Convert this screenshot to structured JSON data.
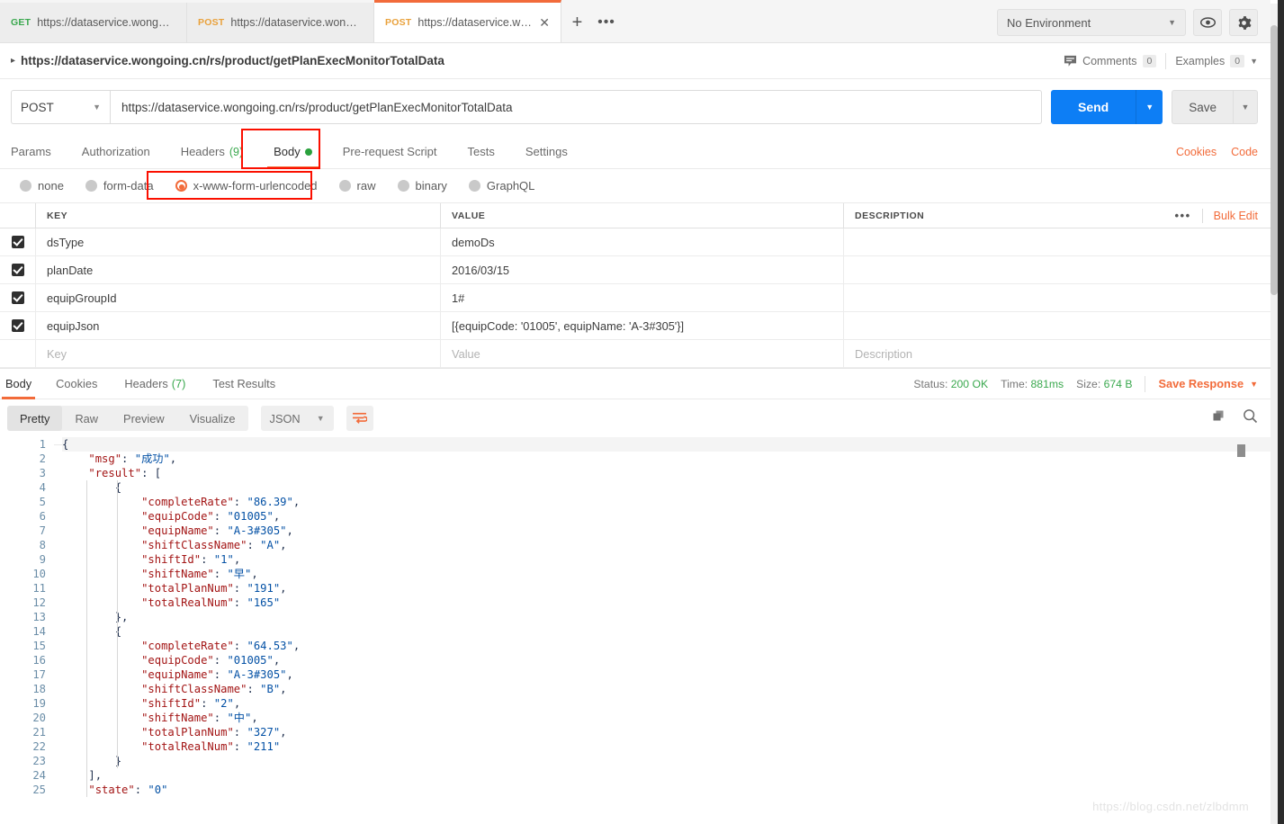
{
  "tabbar": {
    "tabs": [
      {
        "verb": "GET",
        "url": "https://dataservice.wongoing.c...",
        "active": false
      },
      {
        "verb": "POST",
        "url": "https://dataservice.wongoing....",
        "active": false
      },
      {
        "verb": "POST",
        "url": "https://dataservice.wongoing....",
        "active": true
      }
    ],
    "new_tab_label": "+",
    "more_label": "•••",
    "environment": "No Environment",
    "eye_icon": "eye-icon",
    "gear_icon": "gear-icon"
  },
  "breadcrumb": {
    "title": "https://dataservice.wongoing.cn/rs/product/getPlanExecMonitorTotalData",
    "comments_label": "Comments",
    "comments_count": "0",
    "examples_label": "Examples",
    "examples_count": "0"
  },
  "urlbar": {
    "method": "POST",
    "url": "https://dataservice.wongoing.cn/rs/product/getPlanExecMonitorTotalData",
    "send_label": "Send",
    "save_label": "Save"
  },
  "request_tabs": {
    "items": [
      {
        "label": "Params",
        "badge": "",
        "dot": false,
        "active": false
      },
      {
        "label": "Authorization",
        "badge": "",
        "dot": false,
        "active": false
      },
      {
        "label": "Headers",
        "badge": "(9)",
        "dot": false,
        "active": false
      },
      {
        "label": "Body",
        "badge": "",
        "dot": true,
        "active": true
      },
      {
        "label": "Pre-request Script",
        "badge": "",
        "dot": false,
        "active": false
      },
      {
        "label": "Tests",
        "badge": "",
        "dot": false,
        "active": false
      },
      {
        "label": "Settings",
        "badge": "",
        "dot": false,
        "active": false
      }
    ],
    "cookies_label": "Cookies",
    "code_label": "Code"
  },
  "body_types": {
    "options": [
      {
        "label": "none",
        "selected": false
      },
      {
        "label": "form-data",
        "selected": false
      },
      {
        "label": "x-www-form-urlencoded",
        "selected": true
      },
      {
        "label": "raw",
        "selected": false
      },
      {
        "label": "binary",
        "selected": false
      },
      {
        "label": "GraphQL",
        "selected": false
      }
    ]
  },
  "kvtable": {
    "headers": {
      "key": "KEY",
      "value": "VALUE",
      "description": "DESCRIPTION"
    },
    "dots_label": "•••",
    "bulk_edit_label": "Bulk Edit",
    "rows": [
      {
        "checked": true,
        "key": "dsType",
        "value": "demoDs",
        "description": ""
      },
      {
        "checked": true,
        "key": "planDate",
        "value": "2016/03/15",
        "description": ""
      },
      {
        "checked": true,
        "key": "equipGroupId",
        "value": "1#",
        "description": ""
      },
      {
        "checked": true,
        "key": "equipJson",
        "value": "[{equipCode: '01005', equipName: 'A-3#305'}]",
        "description": ""
      }
    ],
    "empty_row": {
      "key_placeholder": "Key",
      "value_placeholder": "Value",
      "description_placeholder": "Description"
    }
  },
  "response": {
    "tabs": [
      {
        "label": "Body",
        "badge": "",
        "active": true
      },
      {
        "label": "Cookies",
        "badge": "",
        "active": false
      },
      {
        "label": "Headers",
        "badge": "(7)",
        "active": false
      },
      {
        "label": "Test Results",
        "badge": "",
        "active": false
      }
    ],
    "status_label": "Status:",
    "status_value": "200 OK",
    "time_label": "Time:",
    "time_value": "881ms",
    "size_label": "Size:",
    "size_value": "674 B",
    "save_response_label": "Save Response",
    "viewmodes": [
      {
        "label": "Pretty",
        "active": true
      },
      {
        "label": "Raw",
        "active": false
      },
      {
        "label": "Preview",
        "active": false
      },
      {
        "label": "Visualize",
        "active": false
      }
    ],
    "format": "JSON",
    "wrap_icon": "word-wrap-icon",
    "copy_icon": "copy-icon",
    "search_icon": "search-icon"
  },
  "code": {
    "lines": [
      {
        "n": 1,
        "indent": 0,
        "parts": [
          {
            "t": "pun",
            "s": "{"
          }
        ]
      },
      {
        "n": 2,
        "indent": 1,
        "parts": [
          {
            "t": "key",
            "s": "\"msg\""
          },
          {
            "t": "pun",
            "s": ": "
          },
          {
            "t": "str",
            "s": "\"成功\""
          },
          {
            "t": "pun",
            "s": ","
          }
        ]
      },
      {
        "n": 3,
        "indent": 1,
        "parts": [
          {
            "t": "key",
            "s": "\"result\""
          },
          {
            "t": "pun",
            "s": ": ["
          }
        ]
      },
      {
        "n": 4,
        "indent": 2,
        "parts": [
          {
            "t": "pun",
            "s": "{"
          }
        ]
      },
      {
        "n": 5,
        "indent": 3,
        "parts": [
          {
            "t": "key",
            "s": "\"completeRate\""
          },
          {
            "t": "pun",
            "s": ": "
          },
          {
            "t": "str",
            "s": "\"86.39\""
          },
          {
            "t": "pun",
            "s": ","
          }
        ]
      },
      {
        "n": 6,
        "indent": 3,
        "parts": [
          {
            "t": "key",
            "s": "\"equipCode\""
          },
          {
            "t": "pun",
            "s": ": "
          },
          {
            "t": "str",
            "s": "\"01005\""
          },
          {
            "t": "pun",
            "s": ","
          }
        ]
      },
      {
        "n": 7,
        "indent": 3,
        "parts": [
          {
            "t": "key",
            "s": "\"equipName\""
          },
          {
            "t": "pun",
            "s": ": "
          },
          {
            "t": "str",
            "s": "\"A-3#305\""
          },
          {
            "t": "pun",
            "s": ","
          }
        ]
      },
      {
        "n": 8,
        "indent": 3,
        "parts": [
          {
            "t": "key",
            "s": "\"shiftClassName\""
          },
          {
            "t": "pun",
            "s": ": "
          },
          {
            "t": "str",
            "s": "\"A\""
          },
          {
            "t": "pun",
            "s": ","
          }
        ]
      },
      {
        "n": 9,
        "indent": 3,
        "parts": [
          {
            "t": "key",
            "s": "\"shiftId\""
          },
          {
            "t": "pun",
            "s": ": "
          },
          {
            "t": "str",
            "s": "\"1\""
          },
          {
            "t": "pun",
            "s": ","
          }
        ]
      },
      {
        "n": 10,
        "indent": 3,
        "parts": [
          {
            "t": "key",
            "s": "\"shiftName\""
          },
          {
            "t": "pun",
            "s": ": "
          },
          {
            "t": "str",
            "s": "\"早\""
          },
          {
            "t": "pun",
            "s": ","
          }
        ]
      },
      {
        "n": 11,
        "indent": 3,
        "parts": [
          {
            "t": "key",
            "s": "\"totalPlanNum\""
          },
          {
            "t": "pun",
            "s": ": "
          },
          {
            "t": "str",
            "s": "\"191\""
          },
          {
            "t": "pun",
            "s": ","
          }
        ]
      },
      {
        "n": 12,
        "indent": 3,
        "parts": [
          {
            "t": "key",
            "s": "\"totalRealNum\""
          },
          {
            "t": "pun",
            "s": ": "
          },
          {
            "t": "str",
            "s": "\"165\""
          }
        ]
      },
      {
        "n": 13,
        "indent": 2,
        "parts": [
          {
            "t": "pun",
            "s": "},"
          }
        ]
      },
      {
        "n": 14,
        "indent": 2,
        "parts": [
          {
            "t": "pun",
            "s": "{"
          }
        ]
      },
      {
        "n": 15,
        "indent": 3,
        "parts": [
          {
            "t": "key",
            "s": "\"completeRate\""
          },
          {
            "t": "pun",
            "s": ": "
          },
          {
            "t": "str",
            "s": "\"64.53\""
          },
          {
            "t": "pun",
            "s": ","
          }
        ]
      },
      {
        "n": 16,
        "indent": 3,
        "parts": [
          {
            "t": "key",
            "s": "\"equipCode\""
          },
          {
            "t": "pun",
            "s": ": "
          },
          {
            "t": "str",
            "s": "\"01005\""
          },
          {
            "t": "pun",
            "s": ","
          }
        ]
      },
      {
        "n": 17,
        "indent": 3,
        "parts": [
          {
            "t": "key",
            "s": "\"equipName\""
          },
          {
            "t": "pun",
            "s": ": "
          },
          {
            "t": "str",
            "s": "\"A-3#305\""
          },
          {
            "t": "pun",
            "s": ","
          }
        ]
      },
      {
        "n": 18,
        "indent": 3,
        "parts": [
          {
            "t": "key",
            "s": "\"shiftClassName\""
          },
          {
            "t": "pun",
            "s": ": "
          },
          {
            "t": "str",
            "s": "\"B\""
          },
          {
            "t": "pun",
            "s": ","
          }
        ]
      },
      {
        "n": 19,
        "indent": 3,
        "parts": [
          {
            "t": "key",
            "s": "\"shiftId\""
          },
          {
            "t": "pun",
            "s": ": "
          },
          {
            "t": "str",
            "s": "\"2\""
          },
          {
            "t": "pun",
            "s": ","
          }
        ]
      },
      {
        "n": 20,
        "indent": 3,
        "parts": [
          {
            "t": "key",
            "s": "\"shiftName\""
          },
          {
            "t": "pun",
            "s": ": "
          },
          {
            "t": "str",
            "s": "\"中\""
          },
          {
            "t": "pun",
            "s": ","
          }
        ]
      },
      {
        "n": 21,
        "indent": 3,
        "parts": [
          {
            "t": "key",
            "s": "\"totalPlanNum\""
          },
          {
            "t": "pun",
            "s": ": "
          },
          {
            "t": "str",
            "s": "\"327\""
          },
          {
            "t": "pun",
            "s": ","
          }
        ]
      },
      {
        "n": 22,
        "indent": 3,
        "parts": [
          {
            "t": "key",
            "s": "\"totalRealNum\""
          },
          {
            "t": "pun",
            "s": ": "
          },
          {
            "t": "str",
            "s": "\"211\""
          }
        ]
      },
      {
        "n": 23,
        "indent": 2,
        "parts": [
          {
            "t": "pun",
            "s": "}"
          }
        ]
      },
      {
        "n": 24,
        "indent": 1,
        "parts": [
          {
            "t": "pun",
            "s": "],"
          }
        ]
      },
      {
        "n": 25,
        "indent": 1,
        "parts": [
          {
            "t": "key",
            "s": "\"state\""
          },
          {
            "t": "pun",
            "s": ": "
          },
          {
            "t": "str",
            "s": "\"0\""
          }
        ]
      }
    ]
  },
  "watermark": "https://blog.csdn.net/zlbdmm",
  "colors": {
    "accent": "#f26b3a",
    "send_blue": "#0d7ef5",
    "green": "#3aa84e",
    "annotation_red": "#fb0f00"
  }
}
